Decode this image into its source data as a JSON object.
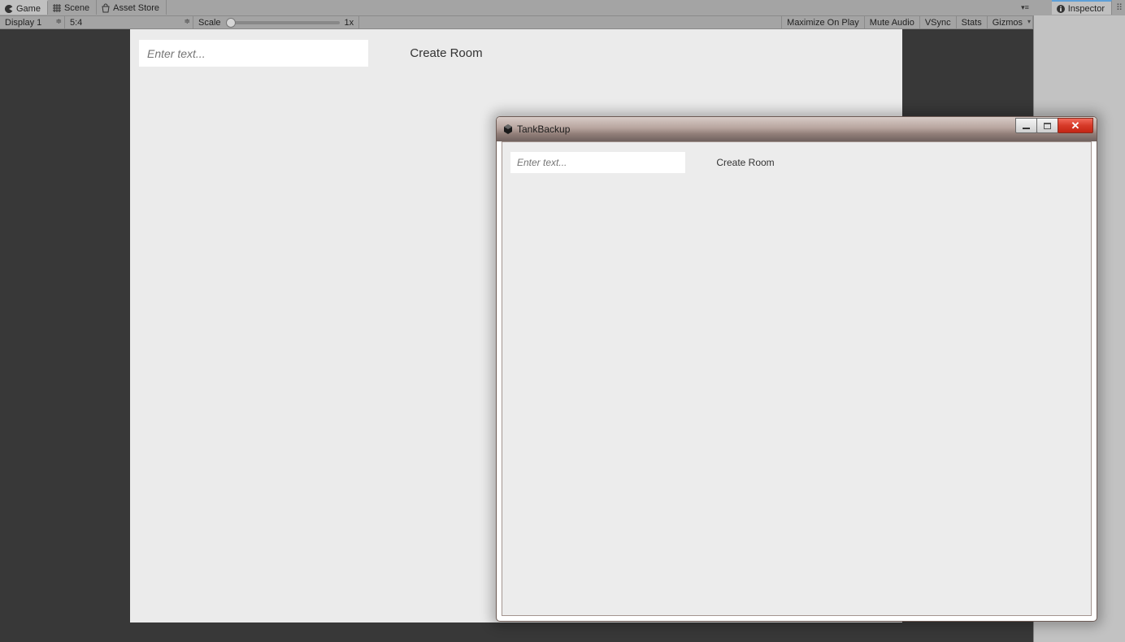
{
  "tabs": {
    "game": "Game",
    "scene": "Scene",
    "asset_store": "Asset Store",
    "inspector": "Inspector"
  },
  "toolbar": {
    "display": "Display 1",
    "aspect": "5:4",
    "scale_label": "Scale",
    "scale_value": "1x",
    "maximize": "Maximize On Play",
    "mute": "Mute Audio",
    "vsync": "VSync",
    "stats": "Stats",
    "gizmos": "Gizmos"
  },
  "game_view": {
    "input_placeholder": "Enter text...",
    "create_room": "Create Room"
  },
  "standalone": {
    "title": "TankBackup",
    "input_placeholder": "Enter text...",
    "create_room": "Create Room"
  }
}
